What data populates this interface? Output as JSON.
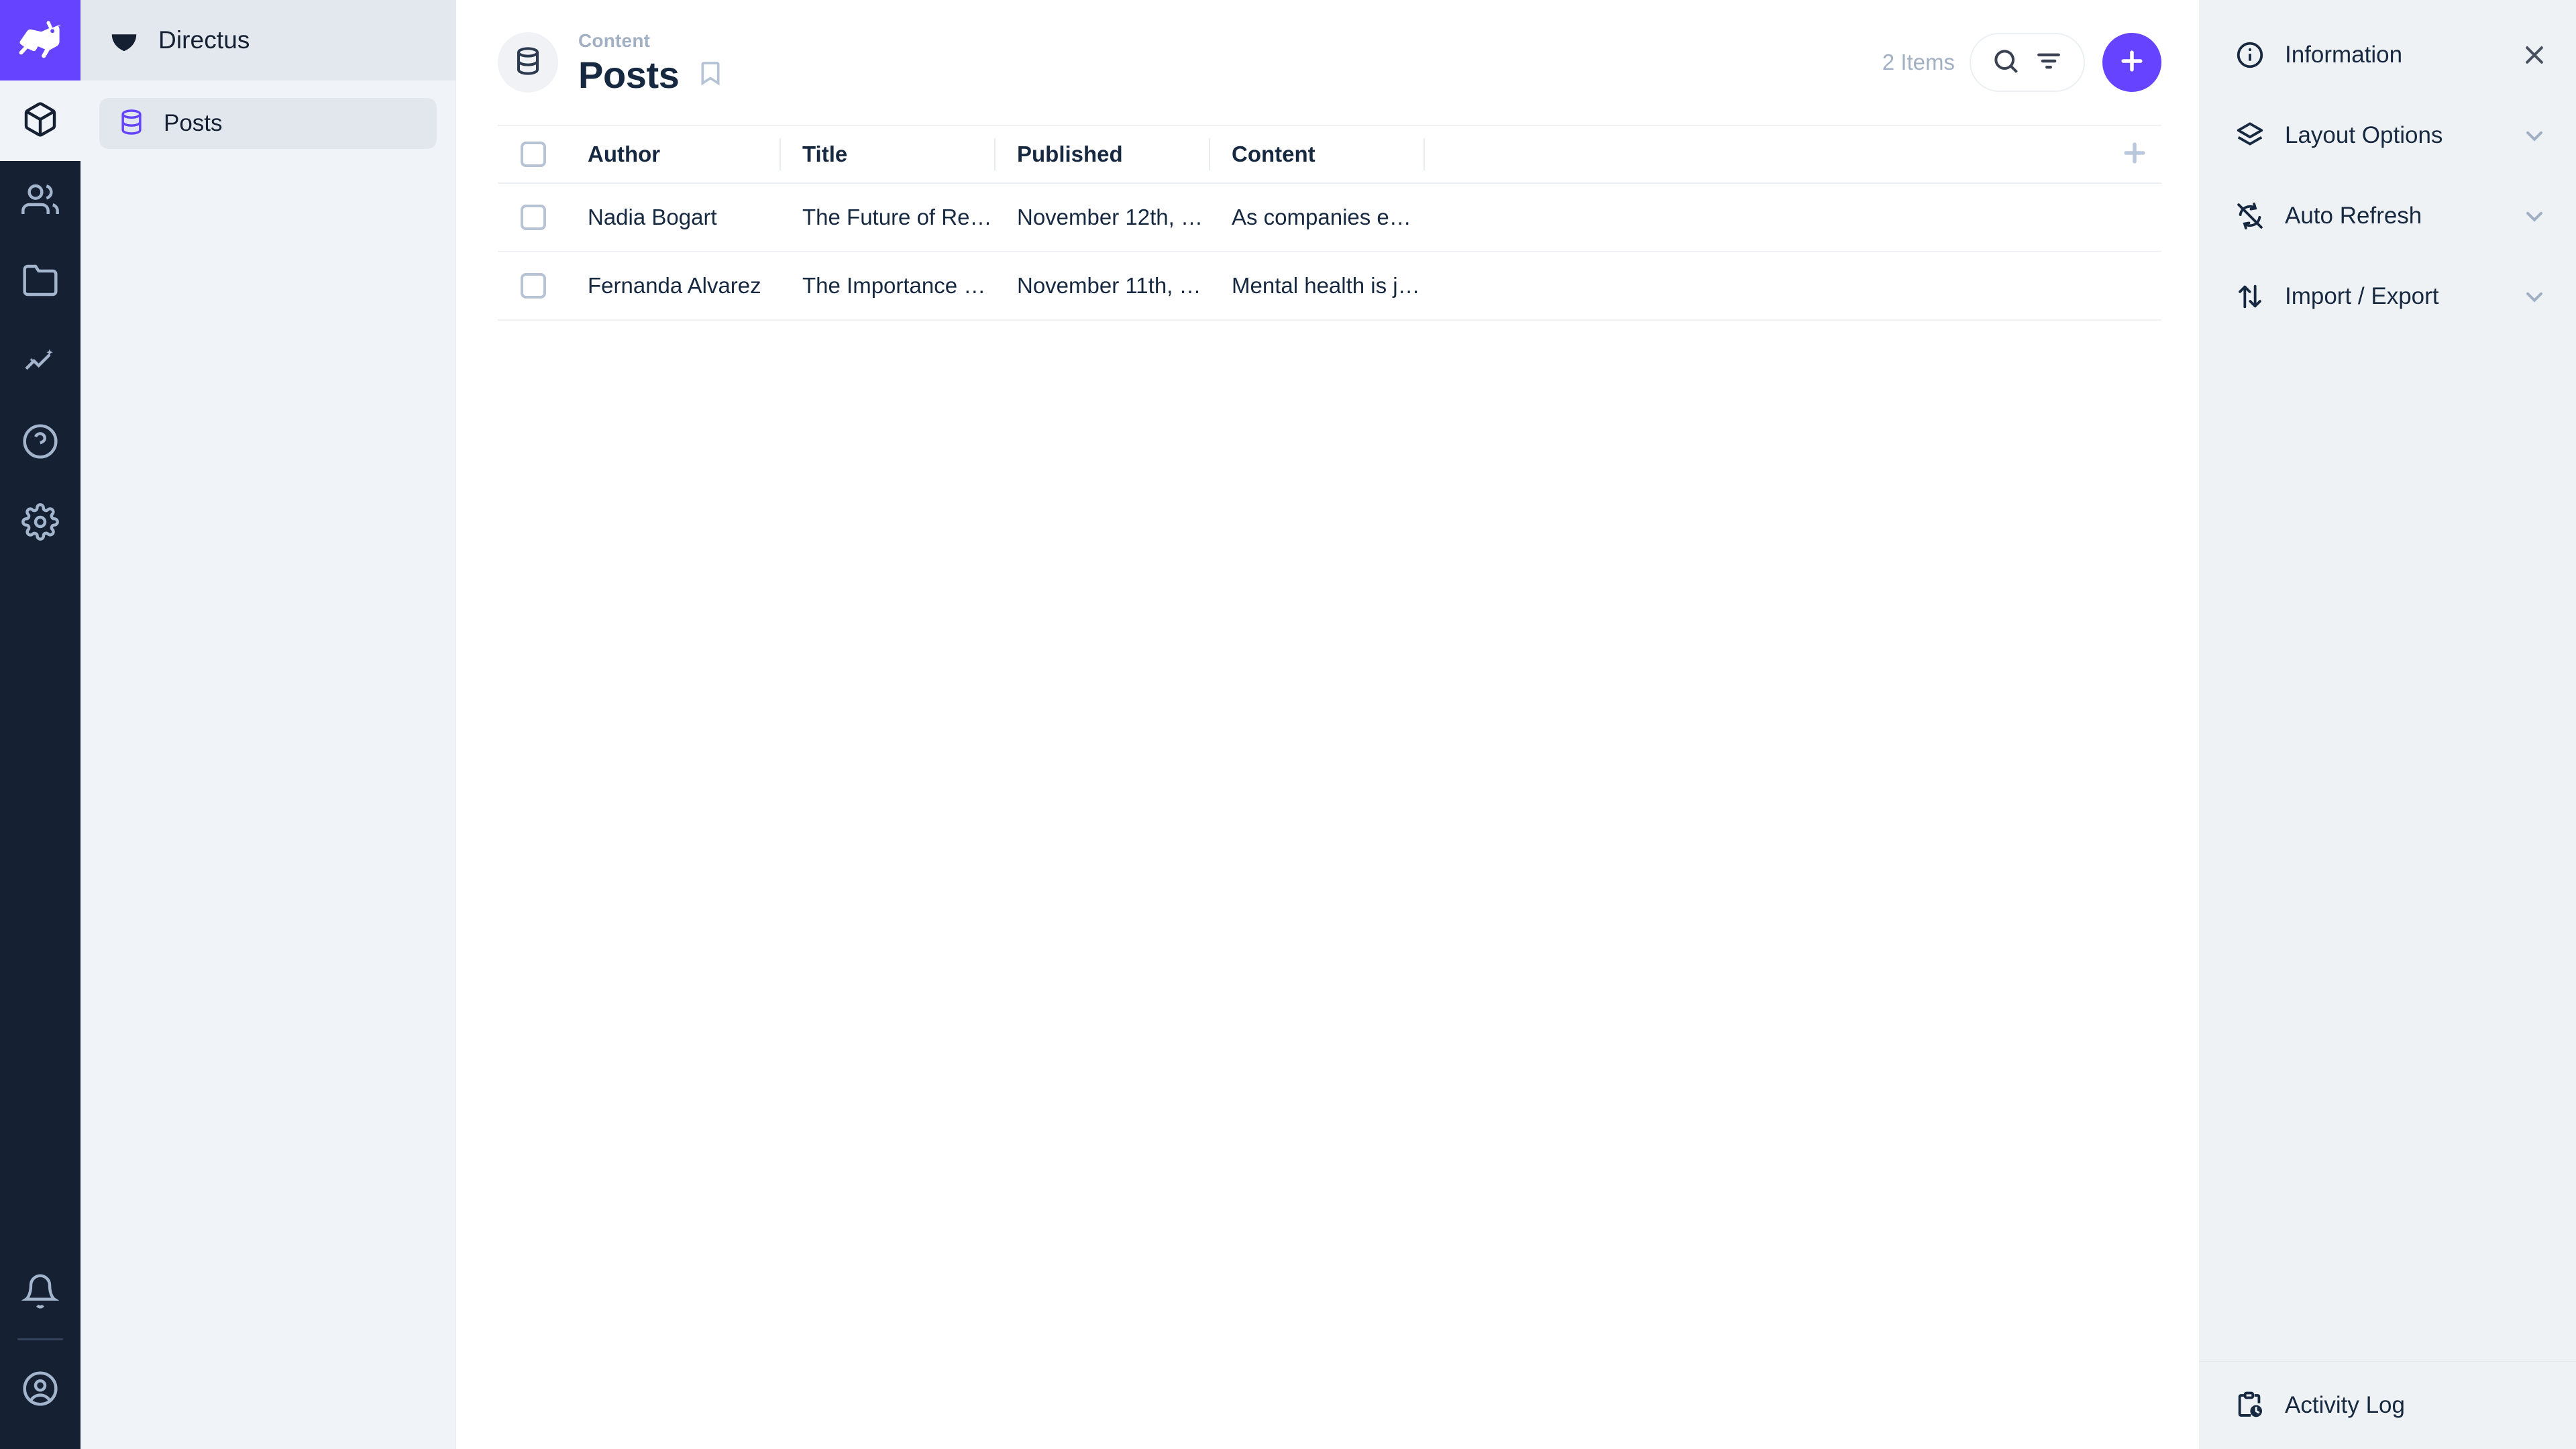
{
  "brand": {
    "logo_icon": "directus-rabbit-logo",
    "logo_bg": "#6644ff",
    "project_name": "Directus",
    "project_icon": "directus-diamond-icon"
  },
  "module_bar": {
    "items": [
      {
        "name": "content",
        "icon": "box-icon",
        "active": true
      },
      {
        "name": "user-directory",
        "icon": "users-icon",
        "active": false
      },
      {
        "name": "file-library",
        "icon": "folder-icon",
        "active": false
      },
      {
        "name": "insights",
        "icon": "insights-chart-icon",
        "active": false
      },
      {
        "name": "documentation",
        "icon": "help-circle-icon",
        "active": false
      },
      {
        "name": "settings",
        "icon": "gear-icon",
        "active": false
      }
    ],
    "bottom_items": [
      {
        "name": "notifications",
        "icon": "bell-icon"
      },
      {
        "name": "account",
        "icon": "user-circle-icon"
      }
    ]
  },
  "sidebar": {
    "items": [
      {
        "label": "Posts",
        "icon": "database-icon",
        "active": true
      }
    ]
  },
  "header": {
    "breadcrumb": "Content",
    "title": "Posts",
    "collection_icon": "database-icon",
    "bookmark_icon": "bookmark-icon",
    "item_count": "2 Items",
    "search_icon": "search-icon",
    "filter_icon": "filter-icon",
    "add_icon": "plus-icon",
    "accent_color": "#6644ff"
  },
  "table": {
    "select_all_checkbox": "unchecked",
    "add_field_icon": "plus-icon",
    "columns": [
      {
        "key": "author",
        "label": "Author"
      },
      {
        "key": "title",
        "label": "Title"
      },
      {
        "key": "published",
        "label": "Published"
      },
      {
        "key": "content",
        "label": "Content"
      }
    ],
    "rows": [
      {
        "author": "Nadia Bogart",
        "title": "The Future of Re…",
        "published": "November 12th, …",
        "content": "As companies e…"
      },
      {
        "author": "Fernanda Alvarez",
        "title": "The Importance …",
        "published": "November 11th, …",
        "content": "Mental health is j…"
      }
    ]
  },
  "right_panel": {
    "sections": [
      {
        "label": "Information",
        "icon": "info-circle-icon",
        "trailing": "close-icon"
      },
      {
        "label": "Layout Options",
        "icon": "layers-icon",
        "trailing": "chevron-down-icon"
      },
      {
        "label": "Auto Refresh",
        "icon": "auto-refresh-off-icon",
        "trailing": "chevron-down-icon"
      },
      {
        "label": "Import / Export",
        "icon": "import-export-icon",
        "trailing": "chevron-down-icon"
      }
    ],
    "footer": {
      "label": "Activity Log",
      "icon": "activity-log-icon"
    }
  }
}
